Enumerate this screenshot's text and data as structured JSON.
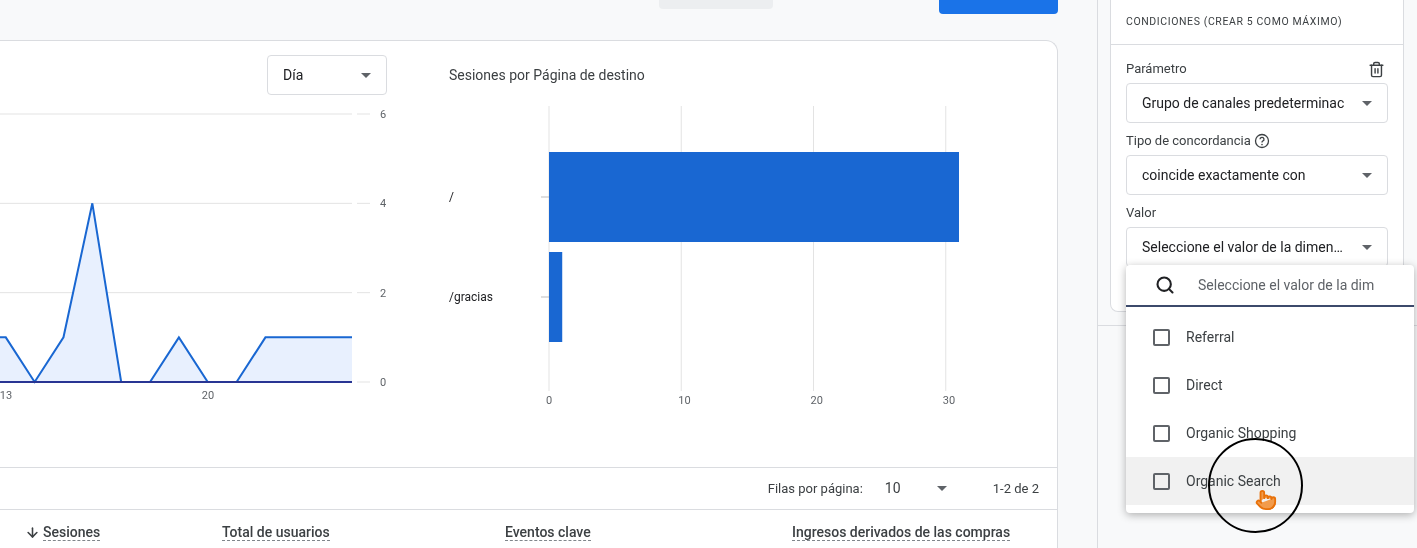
{
  "granularity_select": {
    "value": "Día"
  },
  "line_chart": {
    "chart_data": {
      "type": "area",
      "x": [
        12.8,
        13,
        14,
        15,
        16,
        17,
        18,
        19,
        20,
        21,
        22,
        23,
        24,
        25
      ],
      "values": [
        1,
        1,
        0,
        1,
        4,
        0,
        0,
        1,
        0,
        0,
        1,
        1,
        1,
        1
      ],
      "xlim": [
        12.8,
        25
      ],
      "ylim": [
        0,
        6
      ],
      "xticks": [
        13,
        20
      ],
      "yticks": [
        0,
        2,
        4,
        6
      ],
      "grid": true
    }
  },
  "bar_chart": {
    "chart_data": {
      "type": "bar",
      "title": "Sesiones por Página de destino",
      "orientation": "horizontal",
      "categories": [
        "/",
        "/gracias"
      ],
      "values": [
        31,
        1
      ],
      "xlim": [
        0,
        31
      ],
      "xticks": [
        0,
        10,
        20,
        30
      ],
      "grid": true
    }
  },
  "pagination": {
    "rows_label": "Filas por página:",
    "rows_value": "10",
    "range": "1-2 de 2"
  },
  "table": {
    "columns": [
      {
        "label": "Sesiones",
        "sorted": true
      },
      {
        "label": "Total de usuarios",
        "sorted": false
      },
      {
        "label": "Eventos clave",
        "sorted": false
      },
      {
        "label": "Ingresos derivados de las compras",
        "sorted": false
      }
    ]
  },
  "conditions": {
    "title": "CONDICIONES (CREAR 5 COMO MÁXIMO)",
    "fields": [
      {
        "label": "Parámetro",
        "value": "Grupo de canales predeterminac",
        "help": false,
        "deletable": true
      },
      {
        "label": "Tipo de concordancia",
        "value": "coincide exactamente con",
        "help": true,
        "deletable": false
      },
      {
        "label": "Valor",
        "value": "Seleccione el valor de la dimen…",
        "help": false,
        "deletable": false
      }
    ]
  },
  "value_menu": {
    "search_placeholder": "Seleccione el valor de la dim",
    "options": [
      {
        "label": "Referral",
        "checked": false,
        "highlighted": false
      },
      {
        "label": "Direct",
        "checked": false,
        "highlighted": false
      },
      {
        "label": "Organic Shopping",
        "checked": false,
        "highlighted": false
      },
      {
        "label": "Organic Search",
        "checked": false,
        "highlighted": true
      }
    ]
  },
  "cursor": {
    "kind": "click-highlight"
  }
}
